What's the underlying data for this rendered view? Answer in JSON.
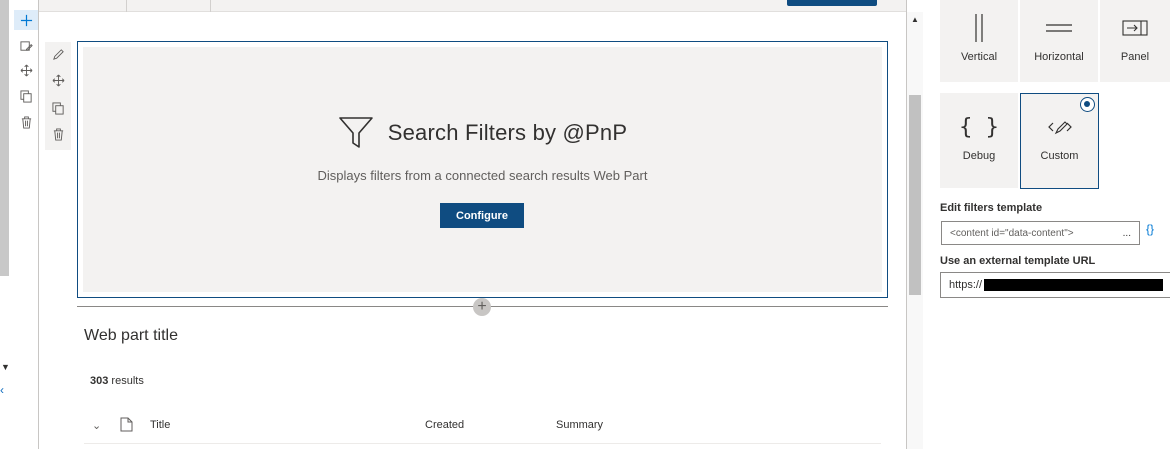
{
  "colors": {
    "accent": "#0f4c81",
    "link": "#0078d4",
    "placeholder_bg": "#f3f2f1"
  },
  "section_toolbar": {
    "items": [
      {
        "name": "add-icon"
      },
      {
        "name": "edit-section-icon"
      },
      {
        "name": "move-icon"
      },
      {
        "name": "duplicate-icon"
      },
      {
        "name": "delete-icon"
      }
    ]
  },
  "webpart_toolbar": {
    "items": [
      {
        "name": "edit-pencil-icon"
      },
      {
        "name": "move-icon"
      },
      {
        "name": "duplicate-icon"
      },
      {
        "name": "delete-icon"
      }
    ]
  },
  "placeholder": {
    "icon": "filter-icon",
    "title": "Search Filters by @PnP",
    "description": "Displays filters from a connected search results Web Part",
    "button_label": "Configure"
  },
  "results_webpart": {
    "title": "Web part title",
    "count": "303",
    "count_suffix": "results",
    "columns": [
      "Title",
      "Created",
      "Summary"
    ]
  },
  "layout_tiles": [
    {
      "label": "Vertical",
      "icon": "vertical-lines-icon",
      "selected": false
    },
    {
      "label": "Horizontal",
      "icon": "horizontal-lines-icon",
      "selected": false
    },
    {
      "label": "Panel",
      "icon": "panel-icon",
      "selected": false
    },
    {
      "label": "Debug",
      "icon": "braces-icon",
      "selected": false
    },
    {
      "label": "Custom",
      "icon": "code-edit-icon",
      "selected": true
    }
  ],
  "template_field": {
    "label": "Edit filters template",
    "value": "<content id=\"data-content\">",
    "more": "...",
    "braces": "{}"
  },
  "url_field": {
    "label": "Use an external template URL",
    "value_prefix": "https://"
  }
}
